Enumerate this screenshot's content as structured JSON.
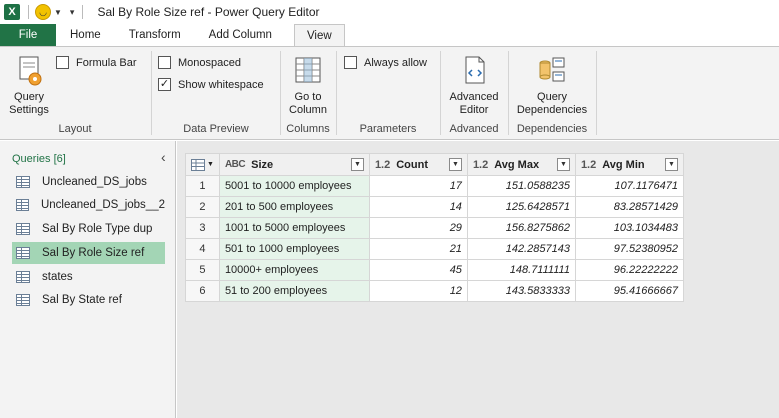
{
  "window": {
    "title": "Sal By Role Size ref - Power Query Editor",
    "app_logo": "X"
  },
  "tabs": [
    {
      "label": "File"
    },
    {
      "label": "Home"
    },
    {
      "label": "Transform"
    },
    {
      "label": "Add Column"
    },
    {
      "label": "View"
    }
  ],
  "ribbon": {
    "layout": {
      "label": "Layout",
      "query_settings": "Query\nSettings",
      "formula_bar": "Formula Bar",
      "formula_bar_checked": false
    },
    "data_preview": {
      "label": "Data Preview",
      "monospaced": "Monospaced",
      "monospaced_checked": false,
      "show_whitespace": "Show whitespace",
      "show_whitespace_checked": true
    },
    "columns": {
      "label": "Columns",
      "go_to_column": "Go to\nColumn"
    },
    "parameters": {
      "label": "Parameters",
      "always_allow": "Always allow",
      "always_allow_checked": false
    },
    "advanced": {
      "label": "Advanced",
      "advanced_editor": "Advanced\nEditor"
    },
    "dependencies": {
      "label": "Dependencies",
      "query_dependencies": "Query\nDependencies"
    }
  },
  "queries": {
    "header": "Queries [6]",
    "items": [
      {
        "label": "Uncleaned_DS_jobs",
        "selected": false
      },
      {
        "label": "Uncleaned_DS_jobs__2",
        "selected": false
      },
      {
        "label": "Sal By Role Type dup",
        "selected": false
      },
      {
        "label": "Sal By Role Size ref",
        "selected": true
      },
      {
        "label": "states",
        "selected": false
      },
      {
        "label": "Sal By State ref",
        "selected": false
      }
    ]
  },
  "grid": {
    "columns": [
      {
        "type": "ABC",
        "name": "Size"
      },
      {
        "type": "1.2",
        "name": "Count"
      },
      {
        "type": "1.2",
        "name": "Avg Max"
      },
      {
        "type": "1.2",
        "name": "Avg Min"
      }
    ],
    "rows": [
      {
        "n": "1",
        "size": "5001 to 10000 employees",
        "count": "17",
        "avg_max": "151.0588235",
        "avg_min": "107.1176471"
      },
      {
        "n": "2",
        "size": "201 to 500 employees",
        "count": "14",
        "avg_max": "125.6428571",
        "avg_min": "83.28571429"
      },
      {
        "n": "3",
        "size": "1001 to 5000 employees",
        "count": "29",
        "avg_max": "156.8275862",
        "avg_min": "103.1034483"
      },
      {
        "n": "4",
        "size": "501 to 1000 employees",
        "count": "21",
        "avg_max": "142.2857143",
        "avg_min": "97.52380952"
      },
      {
        "n": "5",
        "size": "10000+ employees",
        "count": "45",
        "avg_max": "148.7111111",
        "avg_min": "96.22222222"
      },
      {
        "n": "6",
        "size": "51 to 200 employees",
        "count": "12",
        "avg_max": "143.5833333",
        "avg_min": "95.41666667"
      }
    ]
  },
  "colors": {
    "accent": "#217346",
    "selected_query": "#a3d5b5",
    "ribbon_bg": "#f3f3f3",
    "main_bg": "#e8e8e8"
  }
}
